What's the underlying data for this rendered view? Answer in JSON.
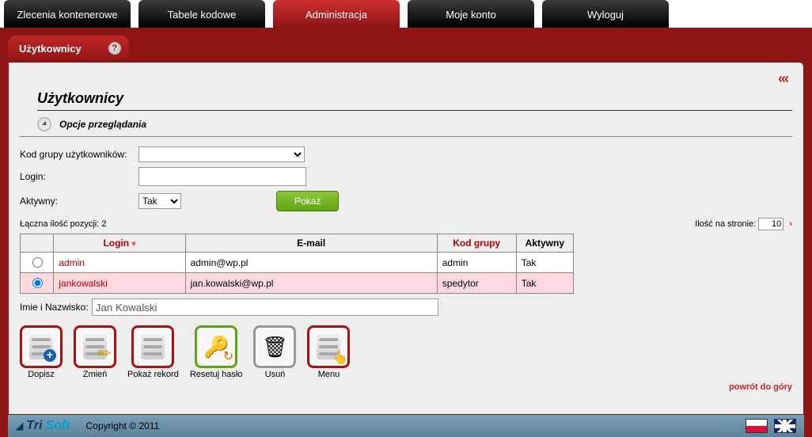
{
  "tabs": [
    {
      "label": "Zlecenia kontenerowe",
      "active": false
    },
    {
      "label": "Tabele kodowe",
      "active": false
    },
    {
      "label": "Administracja",
      "active": true
    },
    {
      "label": "Moje konto",
      "active": false
    },
    {
      "label": "Wyloguj",
      "active": false
    }
  ],
  "subtab": {
    "label": "Użytkownicy"
  },
  "page": {
    "title": "Użytkownicy",
    "options_header": "Opcje przeglądania"
  },
  "filters": {
    "group_label": "Kod grupy użytkowników:",
    "group_value": "",
    "login_label": "Login:",
    "login_value": "",
    "active_label": "Aktywny:",
    "active_value": "Tak",
    "show_button": "Pokaż"
  },
  "meta": {
    "total_label": "Łączna ilość pozycji:",
    "total_value": "2",
    "per_page_label": "Ilość na stronie:",
    "per_page_value": "10"
  },
  "table": {
    "headers": {
      "login": "Login",
      "email": "E-mail",
      "group": "Kod grupy",
      "active": "Aktywny"
    },
    "rows": [
      {
        "selected": false,
        "login": "admin",
        "email": "admin@wp.pl",
        "group": "admin",
        "active": "Tak"
      },
      {
        "selected": true,
        "login": "jankowalski",
        "email": "jan.kowalski@wp.pl",
        "group": "spedytor",
        "active": "Tak"
      }
    ]
  },
  "name_field": {
    "label": "Imie i Nazwisko:",
    "value": "Jan Kowalski"
  },
  "toolbar": {
    "add": "Dopisz",
    "edit": "Zmień",
    "show": "Pokaż rekord",
    "reset": "Resetuj hasło",
    "delete": "Usuń",
    "menu": "Menu"
  },
  "back_to_top": "powrót do góry",
  "footer": {
    "brand1": "Tri",
    "brand2": "Soft",
    "copyright": "Copyright © 2011"
  }
}
